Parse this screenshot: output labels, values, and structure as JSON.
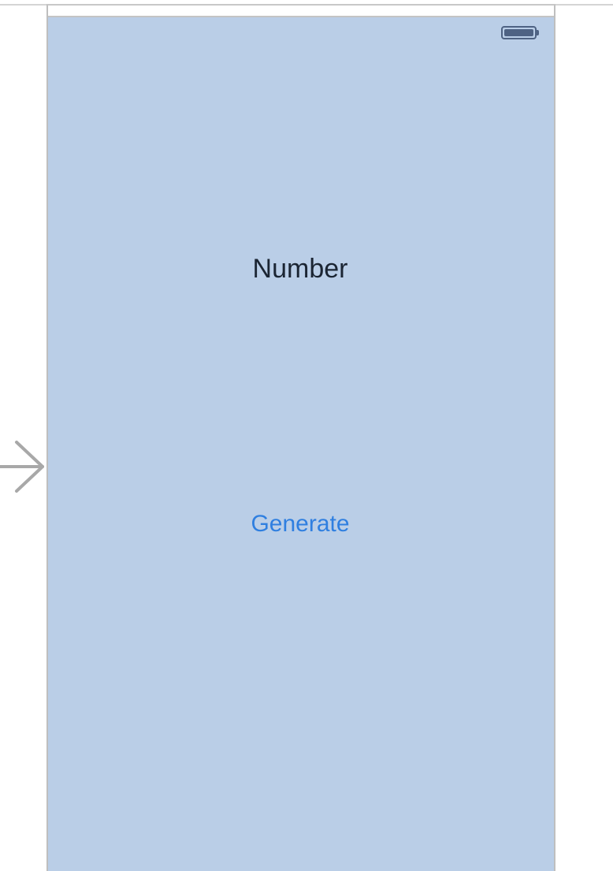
{
  "colors": {
    "view_background": "#bacee7",
    "label_text": "#1b2533",
    "button_tint": "#2f7fe0",
    "battery": "#4e6283",
    "entry_arrow": "#a8a8a8"
  },
  "status_bar": {
    "battery_icon": "battery-full-icon"
  },
  "entry_point": {
    "icon": "arrow-right-icon"
  },
  "main": {
    "number_label": "Number",
    "generate_button_label": "Generate"
  }
}
